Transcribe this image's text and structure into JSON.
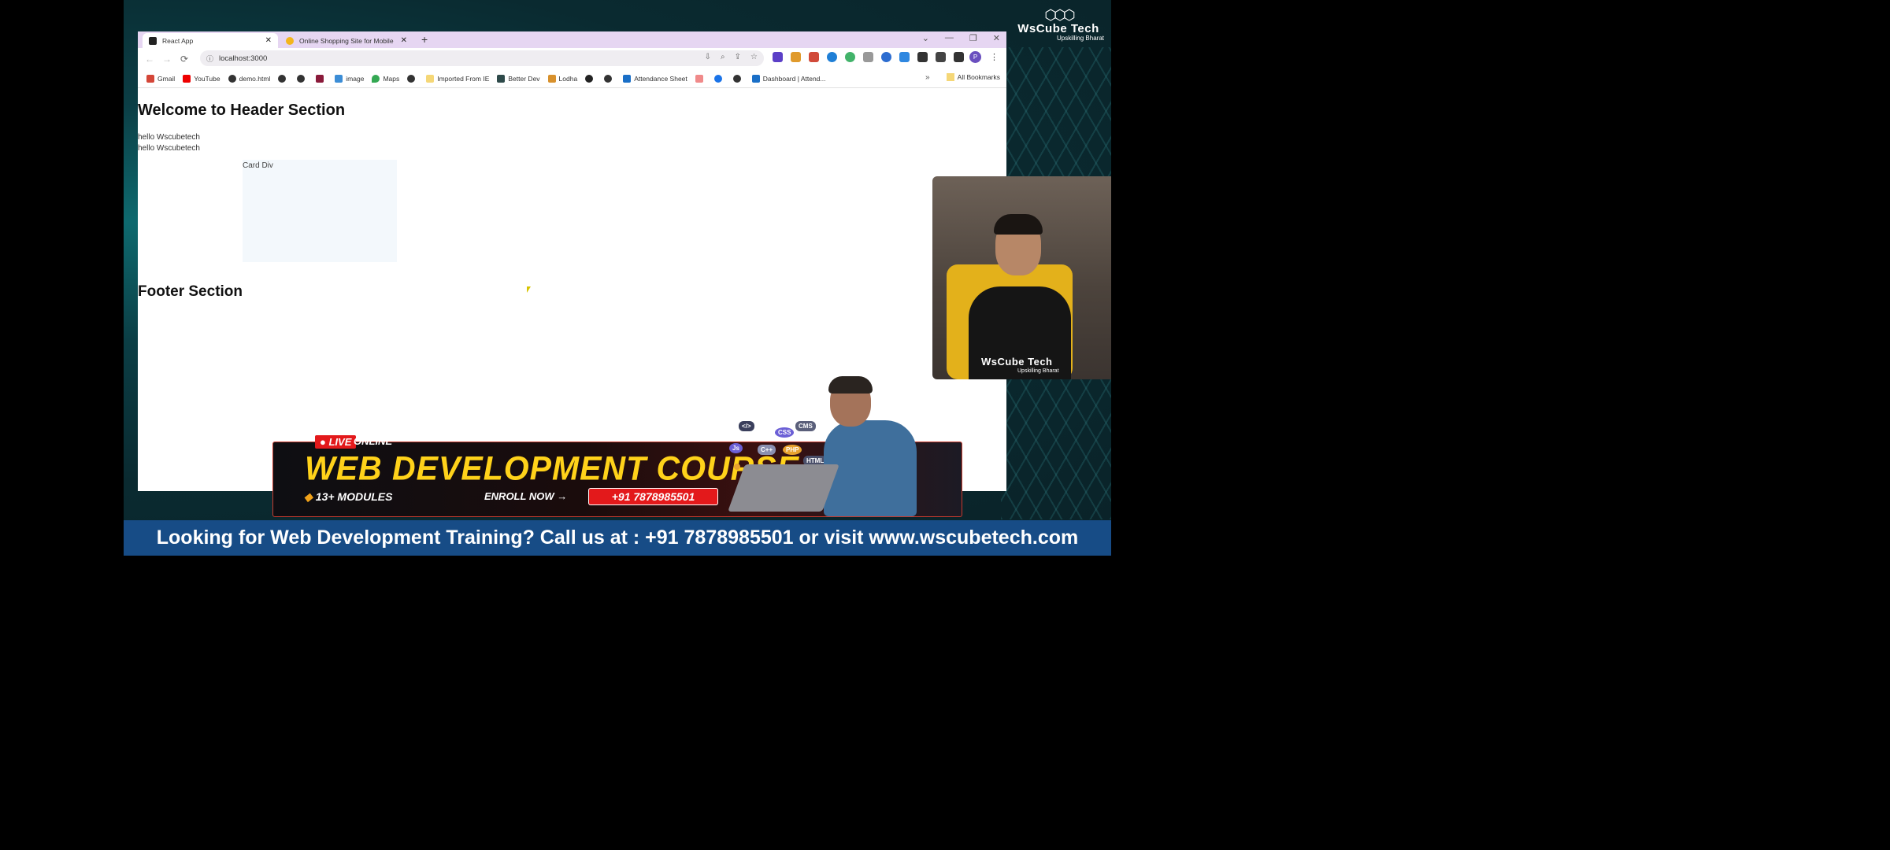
{
  "browser": {
    "tabs": [
      {
        "title": "React App",
        "active": true
      },
      {
        "title": "Online Shopping Site for Mobile",
        "active": false
      }
    ],
    "url": "localhost:3000",
    "bookmarks": [
      "Gmail",
      "YouTube",
      "demo.html",
      "image",
      "Maps",
      "Imported From IE",
      "Better Dev",
      "Lodha",
      "Attendance Sheet",
      "Dashboard | Attend..."
    ],
    "all_bookmarks": "All Bookmarks",
    "profile_initial": "P"
  },
  "page": {
    "heading": "Welcome to Header Section",
    "lines": [
      "hello Wscubetech",
      "hello Wscubetech"
    ],
    "card_text": "Card Div",
    "footer": "Footer Section"
  },
  "brand": {
    "name": "WsCube Tech",
    "tagline": "Upskilling Bharat"
  },
  "webcam": {
    "logo": "WsCube Tech",
    "tagline": "Upskilling Bharat"
  },
  "banner": {
    "live": "LIVE",
    "online": "ONLINE",
    "title": "WEB DEVELOPMENT COURSE",
    "modules": "13+ MODULES",
    "enroll": "ENROLL NOW →",
    "phone": "+91 7878985501",
    "tech_chips": [
      "</>",
      "CSS",
      "CMS",
      "Js",
      "C++",
      "PHP",
      "HTML"
    ]
  },
  "footer_bar": "Looking for Web Development Training? Call us at : +91 7878985501 or visit www.wscubetech.com"
}
